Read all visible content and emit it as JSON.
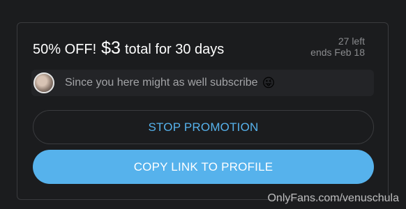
{
  "promotion": {
    "discount": "50% OFF!",
    "price": "$3",
    "duration": "total for 30 days",
    "remaining": "27 left",
    "expiry": "ends Feb 18",
    "message": "Since you here might as well subscribe",
    "message_emoji": "😜"
  },
  "actions": {
    "stop_label": "STOP PROMOTION",
    "copy_label": "COPY LINK TO PROFILE"
  },
  "watermark": "OnlyFans.com/venuschula",
  "colors": {
    "accent": "#56b2ec",
    "background": "#1b1c1e",
    "message_bg": "#232427"
  }
}
